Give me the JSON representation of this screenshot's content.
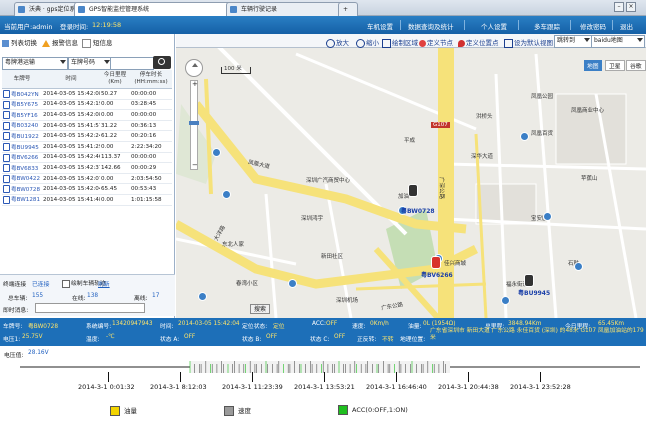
{
  "browser": {
    "tabs": [
      {
        "label": "沃典 · gps定位系统"
      },
      {
        "label": "GPS智能监控管理系统"
      },
      {
        "label": "车辆行驶记录"
      }
    ],
    "new_tab": "+"
  },
  "header": {
    "user_label": "当前用户:admin",
    "login_label": "登录时间:",
    "login_time": "12:19:58",
    "nav": [
      "车机设置",
      "数据查询及统计",
      "个人设置",
      "多车跟踪",
      "修改密码",
      "退出"
    ]
  },
  "left": {
    "tools": [
      "列表切换",
      "报警信息",
      "短信息"
    ],
    "filter1": "粤牌港运输",
    "filter2": "车牌号码",
    "search_placeholder": "",
    "columns": [
      "车牌号",
      "时间",
      "今日里程 (Km)",
      "停车时长 (HH:mm:ss)"
    ],
    "rows": [
      {
        "plate": "粤B042YN",
        "time": "2014-03-05 15:42:08",
        "mileage": "50.27",
        "duration": "00:00:00"
      },
      {
        "plate": "粤B5Y675",
        "time": "2014-03-05 15:42:19",
        "mileage": "0.00",
        "duration": "03:28:45"
      },
      {
        "plate": "粤B5YF16",
        "time": "2014-03-05 15:42:08",
        "mileage": "0.00",
        "duration": "00:00:00"
      },
      {
        "plate": "粤B03240",
        "time": "2014-03-05 15:41:57",
        "mileage": "31.22",
        "duration": "00:36:13"
      },
      {
        "plate": "粤BU1922",
        "time": "2014-03-05 15:42:24",
        "mileage": "61.22",
        "duration": "00:20:16"
      },
      {
        "plate": "粤BU9945",
        "time": "2014-03-05 15:41:29",
        "mileage": "0.00",
        "duration": "2:22:34:20"
      },
      {
        "plate": "粤BV6266",
        "time": "2014-03-05 15:42:46",
        "mileage": "113.37",
        "duration": "00:00:00"
      },
      {
        "plate": "粤BV6833",
        "time": "2014-03-05 15:42:37",
        "mileage": "142.66",
        "duration": "00:00:29"
      },
      {
        "plate": "粤BW0422",
        "time": "2014-03-05 15:42:07",
        "mileage": "0.00",
        "duration": "2:03:54:50"
      },
      {
        "plate": "粤BW0728",
        "time": "2014-03-05 15:42:04",
        "mileage": "65.45",
        "duration": "00:53:43"
      },
      {
        "plate": "粤BW1281",
        "time": "2014-03-05 15:41:48",
        "mileage": "0.00",
        "duration": "1:01:15:58"
      }
    ],
    "conn_label": "终端连接",
    "conn_value": "已连接",
    "track_label": "绘制车辆轨迹",
    "refresh": "刷新",
    "total_label": "总车辆:",
    "total": "155",
    "online_label": "在线:",
    "online": "138",
    "offline_label": "离线:",
    "offline": "17",
    "alert_label": "即时消息:",
    "search_button": "搜索"
  },
  "map": {
    "tools": [
      "放大",
      "缩小",
      "绘制区域",
      "定义节点",
      "定义位置点",
      "设为默认视图"
    ],
    "select1": "跳转到",
    "select2": "baidu地图",
    "tabs": [
      "地图",
      "卫星",
      "谷歌"
    ],
    "scale": "100 米",
    "labels": [
      "凤凰大道",
      "广东公路",
      "大洋路",
      "深圳广汽商贸中心",
      "东北人家",
      "春湾小区",
      "新田社区",
      "佳兴商城",
      "石鼓",
      "深圳机场",
      "凤凰公园",
      "洪桥头",
      "深华大道",
      "凤凰百货",
      "苹蕉山",
      "福永街道",
      "深圳鸿宇",
      "G107",
      "广深公路",
      "宝安区",
      "加油",
      "凤凰商业中心",
      "平成"
    ],
    "cars": [
      {
        "plate": "粤BW0728"
      },
      {
        "plate": "粤BU9945"
      },
      {
        "plate": "粤BV6266"
      }
    ]
  },
  "status": {
    "plate_label": "车牌号:",
    "plate": "粤BW0728",
    "sim_label": "系统编号:",
    "sim": "13420947943",
    "time_label": "时间:",
    "time": "2014-03-05 15:42:04",
    "locate_label": "定位状态:",
    "locate": "定位",
    "acc_label": "ACC:",
    "acc": "OFF",
    "speed_label": "速度:",
    "speed": "0Km/h",
    "oil_label": "油量:",
    "oil": "0L (1954Ω)",
    "total_label": "总里程:",
    "total": "3848.94Km",
    "today_label": "今日里程:",
    "today": "65.45Km",
    "voltage1_label": "电压1:",
    "voltage1": "25.75V",
    "temp_label": "温度:",
    "temp": "-℃",
    "statA_label": "状态 A:",
    "statA": "OFF",
    "statB_label": "状态 B:",
    "statB": "OFF",
    "statC_label": "状态 C:",
    "statC": "OFF",
    "forward_label": "正反转:",
    "forward": "不转",
    "addr_label": "地理位置:",
    "addr": "广东省深圳市 新田大道 广东公路 永佳百货 (深圳) 的48米 G107 凤凰加油站的179米",
    "voltage2_label": "电压值:",
    "voltage2": "28.16V"
  },
  "timeline": {
    "labels": [
      "2014-3-1 0:01:32",
      "2014-3-1 8:12:03",
      "2014-3-1 11:23:39",
      "2014-3-1 13:53:21",
      "2014-3-1 16:46:40",
      "2014-3-1 20:44:38",
      "2014-3-1 23:52:28"
    ]
  },
  "legend": {
    "items": [
      {
        "label": "油量",
        "color": "#f2d400"
      },
      {
        "label": "速度",
        "color": "#9a9a9a"
      },
      {
        "label": "ACC(0:OFF,1:ON)",
        "color": "#1fbf1f"
      }
    ]
  },
  "colors": {
    "header": "#1560a6",
    "status": "#1d6fb8",
    "road_yellow": "#f6e27a",
    "highlight": "#ffe56a"
  }
}
